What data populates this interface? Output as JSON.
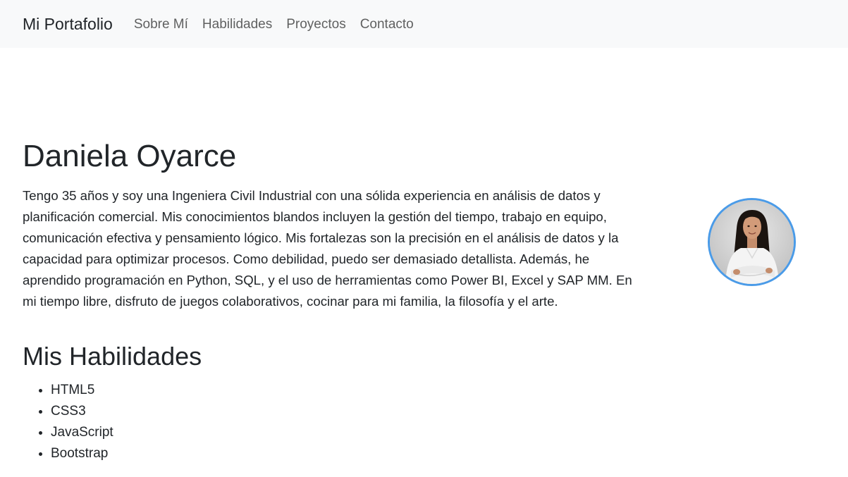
{
  "navbar": {
    "brand": "Mi Portafolio",
    "links": [
      "Sobre Mí",
      "Habilidades",
      "Proyectos",
      "Contacto"
    ]
  },
  "about": {
    "name": "Daniela Oyarce",
    "bio": "Tengo 35 años y soy una Ingeniera Civil Industrial con una sólida experiencia en análisis de datos y planificación comercial. Mis conocimientos blandos incluyen la gestión del tiempo, trabajo en equipo, comunicación efectiva y pensamiento lógico. Mis fortalezas son la precisión en el análisis de datos y la capacidad para optimizar procesos. Como debilidad, puedo ser demasiado detallista. Además, he aprendido programación en Python, SQL, y el uso de herramientas como Power BI, Excel y SAP MM. En mi tiempo libre, disfruto de juegos colaborativos, cocinar para mi familia, la filosofía y el arte."
  },
  "skills": {
    "title": "Mis Habilidades",
    "items": [
      "HTML5",
      "CSS3",
      "JavaScript",
      "Bootstrap"
    ]
  },
  "colors": {
    "navbar_bg": "#f8f9fa",
    "avatar_border": "#4a9be8",
    "text": "#212529"
  }
}
